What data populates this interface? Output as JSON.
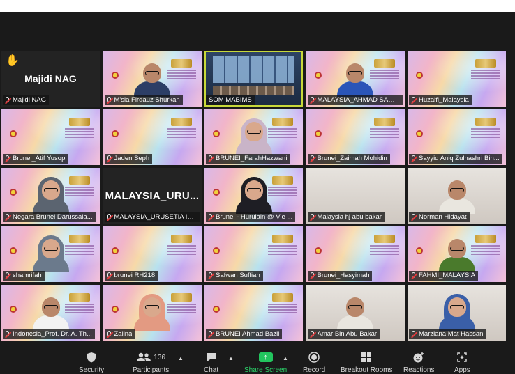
{
  "tiles": [
    {
      "name": "Majidi NAG",
      "big": "Majidi NAG",
      "type": "dark",
      "hand": true
    },
    {
      "name": "M'sia Firdauz Shurkan",
      "type": "banner-person",
      "shirt": "#2c3e66"
    },
    {
      "name": "SOM MABIMS",
      "type": "screen",
      "active": true
    },
    {
      "name": "MALAYSIA_AHMAD SANI AR...",
      "type": "banner-person",
      "shirt": "#2a55b8"
    },
    {
      "name": "Huzaifi_Malaysia",
      "type": "banner"
    },
    {
      "name": "Brunei_Atif Yusop",
      "type": "banner"
    },
    {
      "name": "Jaden Seph",
      "type": "banner"
    },
    {
      "name": "BRUNEI_FarahHazwani",
      "type": "banner-hijab",
      "scarf": "#c9b4c8",
      "shirt": "#c9b4c8"
    },
    {
      "name": "Brunei_Zaimah Mohidin",
      "type": "banner"
    },
    {
      "name": "Sayyid Aniq Zulhashri Bin...",
      "type": "banner"
    },
    {
      "name": "Negara Brunei Darussala...",
      "type": "banner-hijab",
      "scarf": "#5b6470",
      "shirt": "#5b6470"
    },
    {
      "name": "MALAYSIA_URUSETIA IN...",
      "big": "MALAYSIA_URU...",
      "type": "dark"
    },
    {
      "name": "Brunei - Hurulain @ Vie ...",
      "type": "banner-hijab",
      "scarf": "#1e1e24",
      "shirt": "#1e1e24"
    },
    {
      "name": "Malaysia hj abu bakar",
      "type": "room"
    },
    {
      "name": "Norman Hidayat",
      "type": "room-person",
      "shirt": "#e9e6df"
    },
    {
      "name": "shamrifah",
      "type": "banner-hijab",
      "scarf": "#6b7a8c",
      "shirt": "#6b7a8c"
    },
    {
      "name": "brunei RH218",
      "type": "banner"
    },
    {
      "name": "Safwan Suffian",
      "type": "banner"
    },
    {
      "name": "Brunei_Hasyimah",
      "type": "banner"
    },
    {
      "name": "FAHMI_MALAYSIA",
      "type": "banner-person",
      "shirt": "#4a7a2c"
    },
    {
      "name": "Indonesia_Prof. Dr. A. Th...",
      "type": "banner-person",
      "shirt": "#f2f2f2"
    },
    {
      "name": "Zalina",
      "type": "banner-hijab",
      "scarf": "#e39a82",
      "shirt": "#e39a82"
    },
    {
      "name": "BRUNEI Ahmad Bazli",
      "type": "banner"
    },
    {
      "name": "Amar Bin Abu Bakar",
      "type": "room-person",
      "shirt": "#e9e6df"
    },
    {
      "name": "Marziana Mat Hassan",
      "type": "room-hijab",
      "scarf": "#3a5fa8",
      "shirt": "#3a5fa8"
    }
  ],
  "toolbar": {
    "security": "Security",
    "participants": "Participants",
    "participants_count": "136",
    "chat": "Chat",
    "share": "Share Screen",
    "record": "Record",
    "breakout": "Breakout Rooms",
    "reactions": "Reactions",
    "apps": "Apps"
  },
  "colors": {
    "background": "#1a1a1a",
    "active_speaker": "#c8d93a",
    "share_green": "#22c55e",
    "muted_red": "#e5383b"
  }
}
